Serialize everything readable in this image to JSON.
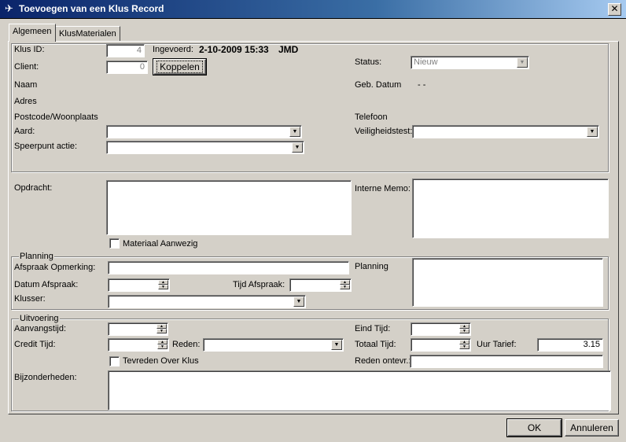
{
  "window": {
    "title": "Toevoegen van een Klus Record",
    "close": "✕"
  },
  "tabs": [
    {
      "label": "Algemeen",
      "active": true
    },
    {
      "label": "KlusMaterialen",
      "active": false
    }
  ],
  "general": {
    "klus_id_label": "Klus ID:",
    "klus_id_value": "4",
    "ingevoerd_label": "Ingevoerd:",
    "ingevoerd_value": "2-10-2009 15:33",
    "ingevoerd_user": "JMD",
    "client_label": "Client:",
    "client_value": "0",
    "koppelen_label": "Koppelen",
    "status_label": "Status:",
    "status_value": "Nieuw",
    "naam_label": "Naam",
    "geb_datum_label": "Geb. Datum",
    "geb_datum_value": "-  -",
    "adres_label": "Adres",
    "postcode_label": "Postcode/Woonplaats",
    "telefoon_label": "Telefoon",
    "aard_label": "Aard:",
    "aard_value": "",
    "veiligheidstest_label": "Veiligheidstest:",
    "veiligheidstest_value": "",
    "speerpunt_label": "Speerpunt actie:",
    "speerpunt_value": ""
  },
  "opdracht": {
    "opdracht_label": "Opdracht:",
    "interne_memo_label": "Interne Memo:",
    "materiaal_label": "Materiaal Aanwezig"
  },
  "planning": {
    "group_label": "Planning",
    "afspraak_label": "Afspraak Opmerking:",
    "planning_label": "Planning",
    "datum_label": "Datum Afspraak:",
    "tijd_label": "Tijd Afspraak:",
    "klusser_label": "Klusser:"
  },
  "uitvoering": {
    "group_label": "Uitvoering",
    "aanvangstijd_label": "Aanvangstijd:",
    "eind_tijd_label": "Eind Tijd:",
    "credit_tijd_label": "Credit Tijd:",
    "reden_label": "Reden:",
    "totaal_tijd_label": "Totaal Tijd:",
    "uur_tarief_label": "Uur Tarief:",
    "uur_tarief_value": "3.15",
    "tevreden_label": "Tevreden Over Klus",
    "reden_ontevr_label": "Reden ontevr.:",
    "bijzonderheden_label": "Bijzonderheden:"
  },
  "footer": {
    "ok_label": "OK",
    "annuleren_label": "Annuleren"
  }
}
